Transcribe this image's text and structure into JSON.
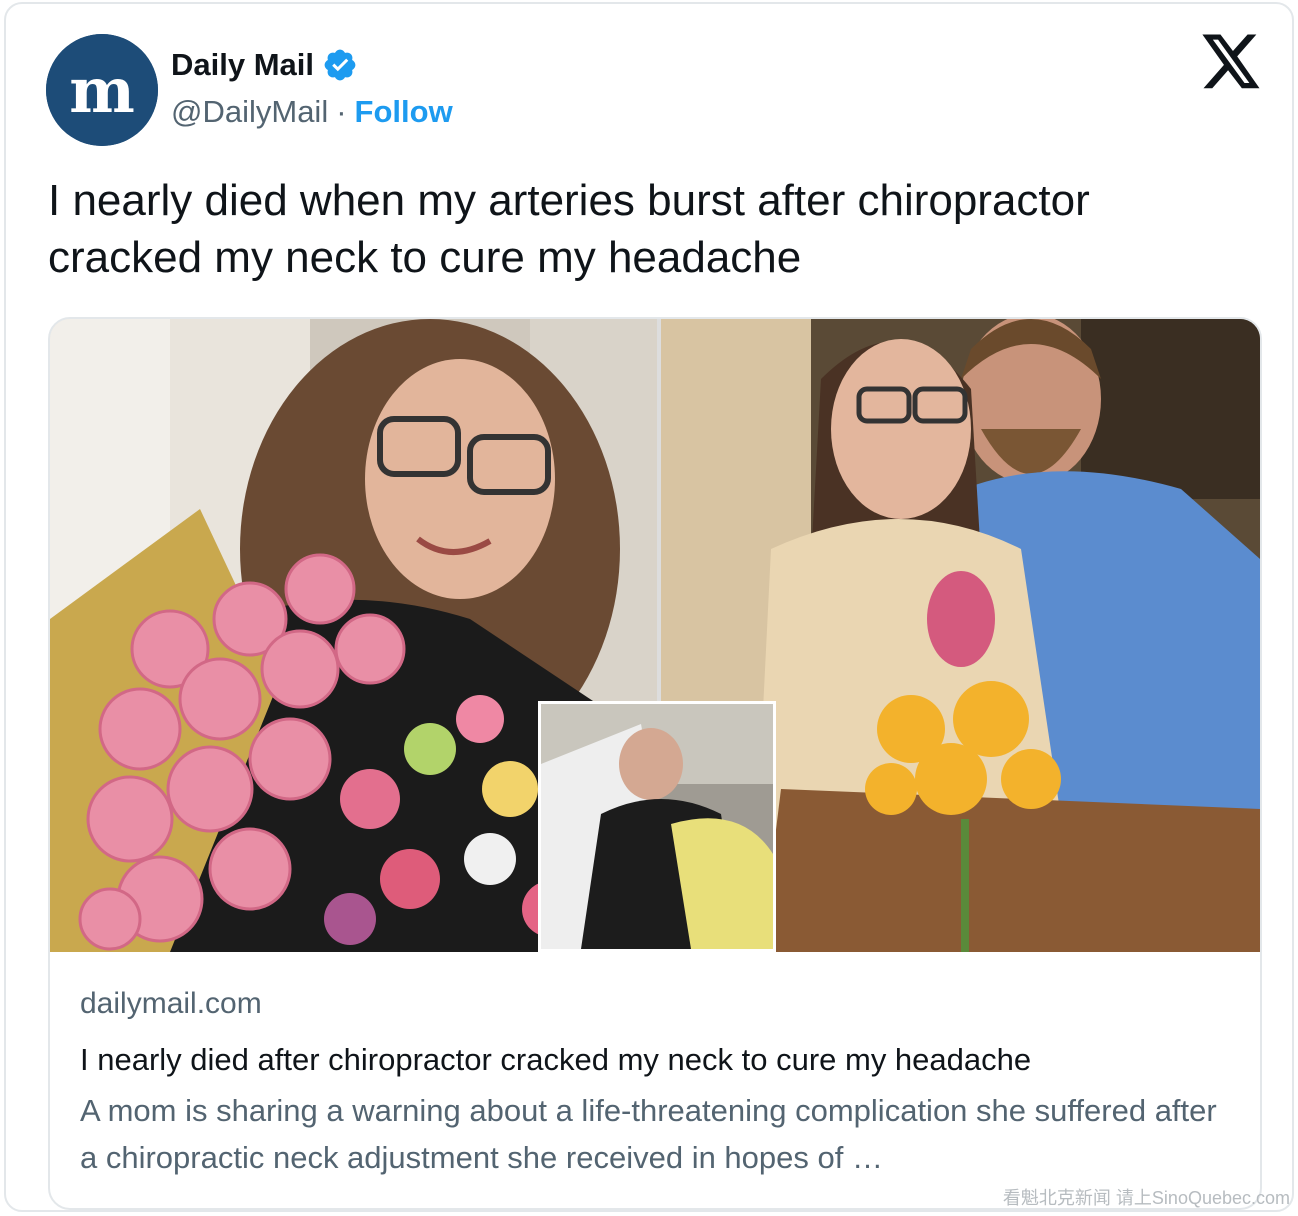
{
  "author": {
    "display_name": "Daily Mail",
    "handle": "@DailyMail",
    "separator": "·",
    "follow_label": "Follow",
    "avatar_icon": "daily-mail-logo-icon",
    "verified_icon": "verified-badge-icon"
  },
  "platform_icon": "x-logo-icon",
  "tweet": {
    "text": "I nearly died when my arteries burst after chiropractor cracked my neck to cure my headache"
  },
  "link_card": {
    "domain": "dailymail.com",
    "title": "I nearly died after chiropractor cracked my neck to cure my headache",
    "description": "A mom is sharing a warning about a life-threatening complication she suffered after a chiropractic neck adjustment she received in hopes of …"
  },
  "watermark": "看魁北克新闻 请上SinoQuebec.com",
  "colors": {
    "brand_blue": "#1d4c78",
    "verified_blue": "#1d9bf0",
    "text_primary": "#0f1419",
    "text_secondary": "#536471",
    "border": "#e3e7ea"
  }
}
